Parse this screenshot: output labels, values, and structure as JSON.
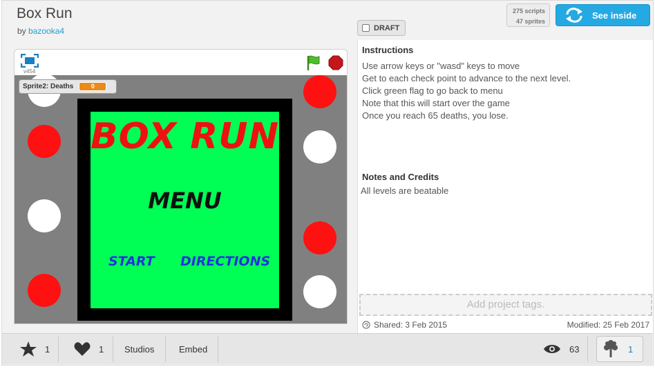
{
  "project": {
    "title": "Box Run",
    "by_label": "by",
    "author": "bazooka4"
  },
  "draft": {
    "label": "DRAFT"
  },
  "counts": {
    "scripts": "275 scripts",
    "sprites": "47 sprites"
  },
  "see_inside": {
    "label": "See inside",
    "color": "#25a9e3"
  },
  "player": {
    "version": "v454",
    "monitor": {
      "label": "Sprite2: Deaths",
      "value": "0"
    },
    "game": {
      "title": "BOX RUN",
      "menu": "MENU",
      "start": "START",
      "directions": "DIRECTIONS"
    },
    "colors": {
      "stage_bg": "#808080",
      "screen_bg": "#00ff55",
      "red": "#ff1111",
      "title_text": "#ee1111",
      "link_text": "#2233dd"
    }
  },
  "instructions": {
    "heading": "Instructions",
    "lines": [
      "Use arrow keys or \"wasd\" keys to move",
      "Get to each check point to advance to the next level.",
      "Click green flag to go back to menu",
      "Note that this will start over the game",
      "Once you reach 65 deaths, you lose."
    ]
  },
  "notes": {
    "heading": "Notes and Credits",
    "text": "All levels are beatable"
  },
  "tags": {
    "placeholder": "Add project tags."
  },
  "dates": {
    "shared": "Shared: 3 Feb 2015",
    "modified": "Modified: 25 Feb 2017"
  },
  "bottom_bar": {
    "favorites": "1",
    "loves": "1",
    "studios": "Studios",
    "embed": "Embed",
    "views": "63",
    "remixes": "1"
  }
}
